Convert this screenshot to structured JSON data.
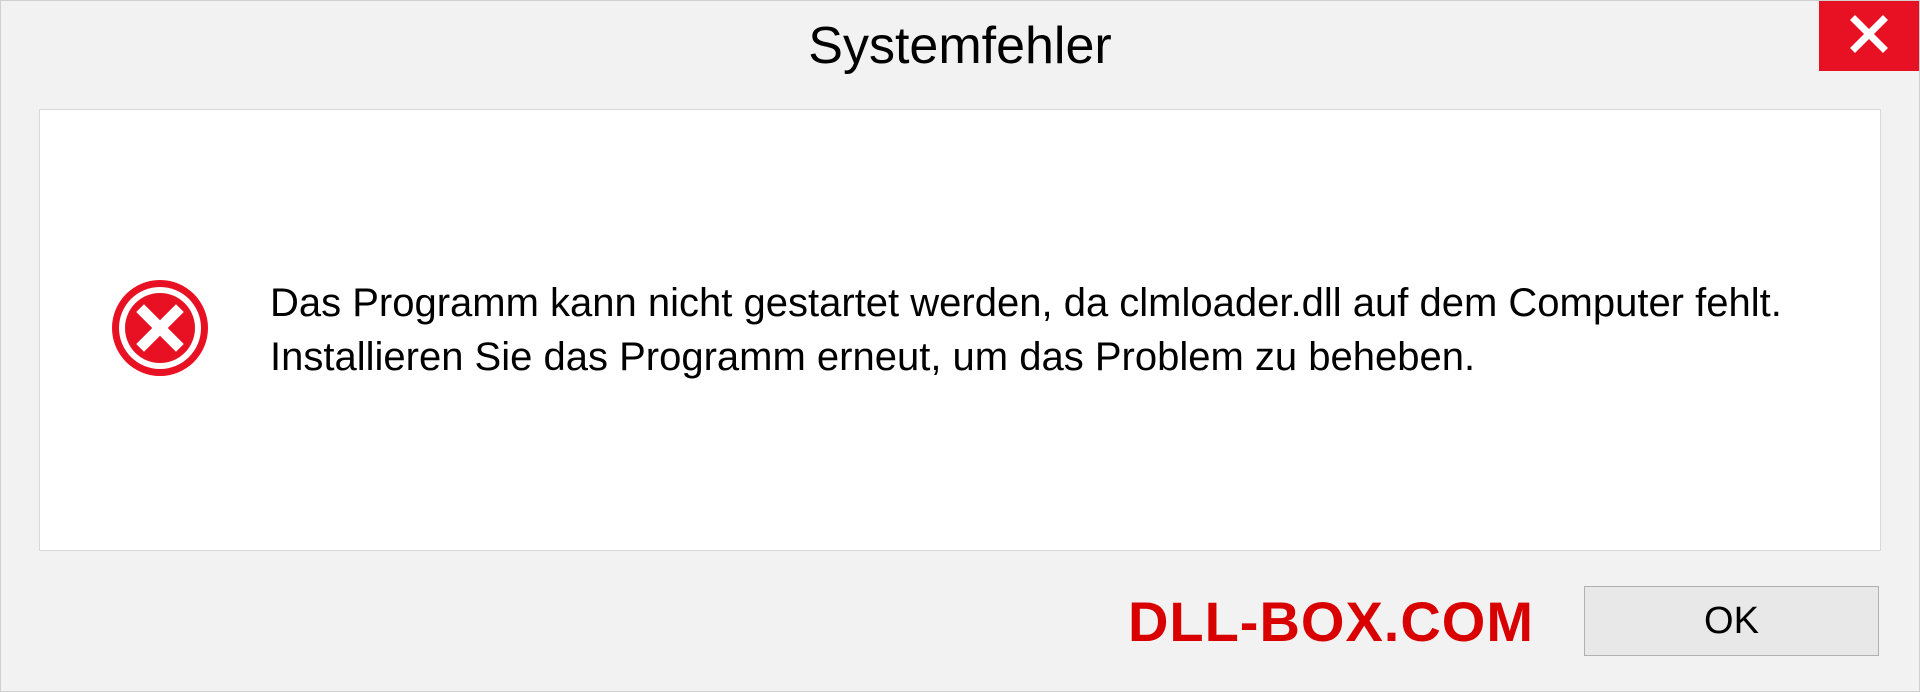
{
  "dialog": {
    "title": "Systemfehler",
    "message": "Das Programm kann nicht gestartet werden, da clmloader.dll auf dem Computer fehlt. Installieren Sie das Programm erneut, um das Problem zu beheben.",
    "ok_label": "OK",
    "watermark": "DLL-BOX.COM"
  },
  "colors": {
    "close_button_bg": "#e81123",
    "watermark_color": "#d90000",
    "error_icon_color": "#e81123"
  }
}
